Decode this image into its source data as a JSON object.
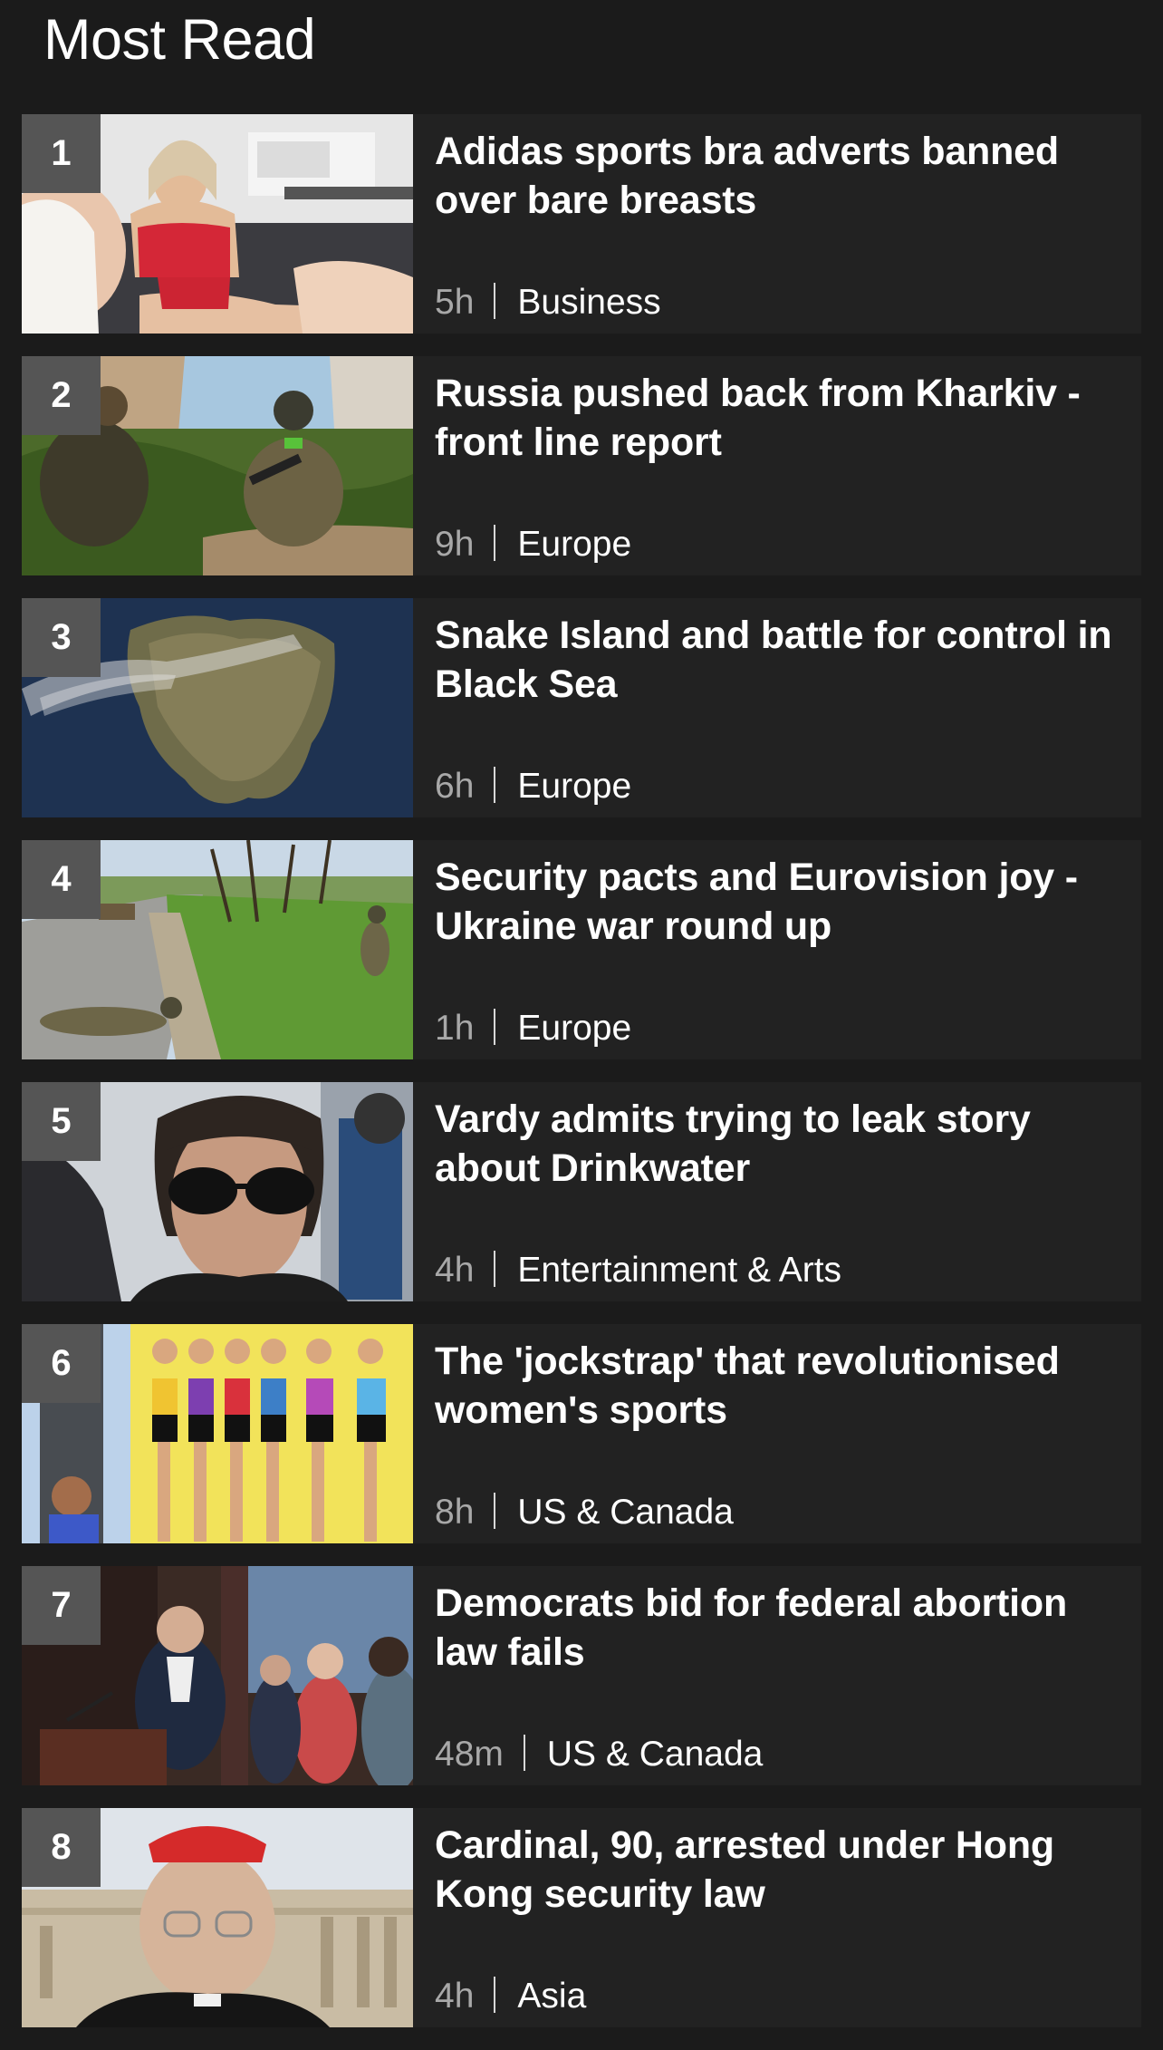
{
  "section": {
    "title": "Most Read"
  },
  "items": [
    {
      "rank": "1",
      "headline": "Adidas sports bra adverts banned over bare breasts",
      "time": "5h",
      "category": "Business",
      "image": "adidas-models-photo"
    },
    {
      "rank": "2",
      "headline": "Russia pushed back from Kharkiv - front line report",
      "time": "9h",
      "category": "Europe",
      "image": "soldiers-by-wall-photo"
    },
    {
      "rank": "3",
      "headline": "Snake Island and battle for control in Black Sea",
      "time": "6h",
      "category": "Europe",
      "image": "satellite-island-photo"
    },
    {
      "rank": "4",
      "headline": "Security pacts and Eurovision joy - Ukraine war round up",
      "time": "1h",
      "category": "Europe",
      "image": "soldiers-on-road-photo"
    },
    {
      "rank": "5",
      "headline": "Vardy admits trying to leak story about Drinkwater",
      "time": "4h",
      "category": "Entertainment & Arts",
      "image": "woman-sunglasses-photo"
    },
    {
      "rank": "6",
      "headline": "The 'jockstrap' that revolutionised women's sports",
      "time": "8h",
      "category": "US & Canada",
      "image": "sports-bra-dancers-photo"
    },
    {
      "rank": "7",
      "headline": "Democrats bid for federal abortion law fails",
      "time": "48m",
      "category": "US & Canada",
      "image": "senate-podium-photo"
    },
    {
      "rank": "8",
      "headline": "Cardinal, 90, arrested under Hong Kong security law",
      "time": "4h",
      "category": "Asia",
      "image": "cardinal-portrait-photo"
    }
  ]
}
